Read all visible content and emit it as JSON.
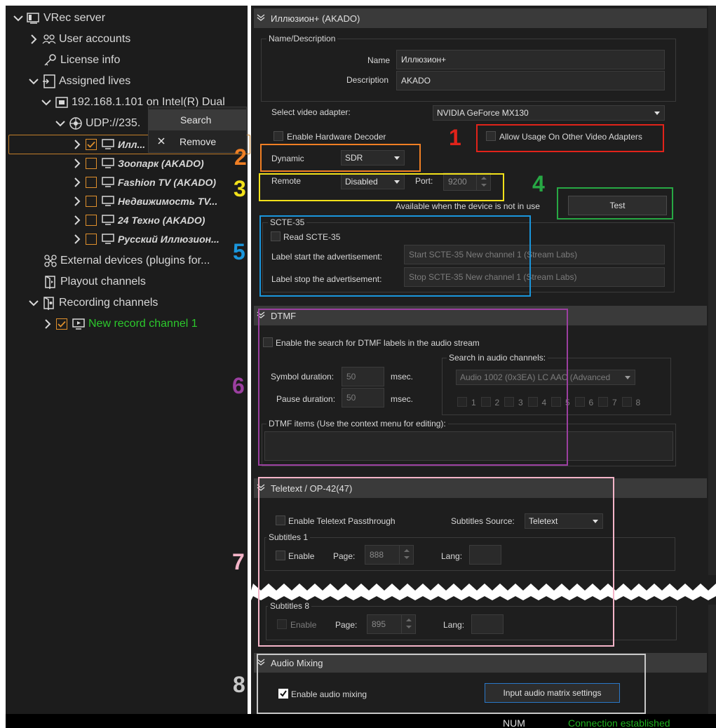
{
  "tree": {
    "root": "VRec server",
    "user_accounts": "User accounts",
    "license_info": "License info",
    "assigned_lives": "Assigned lives",
    "device": "192.168.1.101 on Intel(R) Dual",
    "udp": "UDP://235.",
    "channels": [
      {
        "label": "Илл...",
        "checked": true
      },
      {
        "label": "Зоопарк (AKADO)",
        "checked": false
      },
      {
        "label": "Fashion TV (AKADO)",
        "checked": false
      },
      {
        "label": "Недвижимость TV...",
        "checked": false
      },
      {
        "label": "24 Техно (AKADO)",
        "checked": false
      },
      {
        "label": "Русский Иллюзион...",
        "checked": false
      }
    ],
    "external_devices": "External devices (plugins for...",
    "playout_channels": "Playout channels",
    "recording_channels": "Recording channels",
    "new_record_channel": "New record channel 1"
  },
  "context_menu": {
    "search": "Search",
    "remove": "Remove"
  },
  "header": {
    "title": "Иллюзион+ (AKADO)"
  },
  "name_desc": {
    "group_label": "Name/Description",
    "name_label": "Name",
    "name_value": "Иллюзион+",
    "desc_label": "Description",
    "desc_value": "AKADO"
  },
  "video": {
    "adapter_label": "Select video adapter:",
    "adapter_value": "NVIDIA GeForce MX130",
    "hw_decoder": "Enable Hardware Decoder",
    "allow_other": "Allow Usage On Other Video Adapters",
    "dynamic_label": "Dynamic",
    "dynamic_value": "SDR",
    "remote_label": "Remote",
    "remote_value": "Disabled",
    "port_label": "Port:",
    "port_value": "9200",
    "available_note": "Available when the device is not in use",
    "test_button": "Test"
  },
  "scte": {
    "group_label": "SCTE-35",
    "read": "Read SCTE-35",
    "start_label": "Label start the advertisement:",
    "start_value": "Start SCTE-35 New channel 1 (Stream Labs)",
    "stop_label": "Label stop the advertisement:",
    "stop_value": "Stop SCTE-35 New channel 1 (Stream Labs)"
  },
  "dtmf": {
    "title": "DTMF",
    "enable": "Enable the search for DTMF labels in the audio stream",
    "symbol_label": "Symbol duration:",
    "symbol_value": "50",
    "pause_label": "Pause duration:",
    "pause_value": "50",
    "msec": "msec.",
    "search_group": "Search in audio channels:",
    "audio_value": "Audio 1002 (0x3EA) LC AAC (Advanced",
    "channel_numbers": [
      "1",
      "2",
      "3",
      "4",
      "5",
      "6",
      "7",
      "8"
    ],
    "items_label": "DTMF items (Use the context menu for editing):"
  },
  "teletext": {
    "title": "Teletext / OP-42(47)",
    "passthrough": "Enable Teletext Passthrough",
    "source_label": "Subtitles Source:",
    "source_value": "Teletext",
    "sub1_group": "Subtitles 1",
    "sub1_enable": "Enable",
    "page_label": "Page:",
    "sub1_page": "888",
    "lang_label": "Lang:",
    "sub8_group": "Subtitles 8",
    "sub8_enable": "Enable",
    "sub8_page": "895"
  },
  "audio": {
    "title": "Audio Mixing",
    "enable": "Enable audio mixing",
    "enabled": true,
    "matrix_button": "Input audio matrix settings"
  },
  "annotations": {
    "n1": "1",
    "n2": "2",
    "n3": "3",
    "n4": "4",
    "n5": "5",
    "n6": "6",
    "n7": "7",
    "n8": "8",
    "colors": {
      "n1": "#e2231a",
      "n2": "#f07f24",
      "n3": "#f2e11a",
      "n4": "#27a844",
      "n5": "#1a96dc",
      "n6": "#9b3fa0",
      "n7": "#f4b4c8",
      "n8": "#c8c8c8"
    }
  },
  "status": {
    "num": "NUM",
    "connection": "Connection established"
  }
}
